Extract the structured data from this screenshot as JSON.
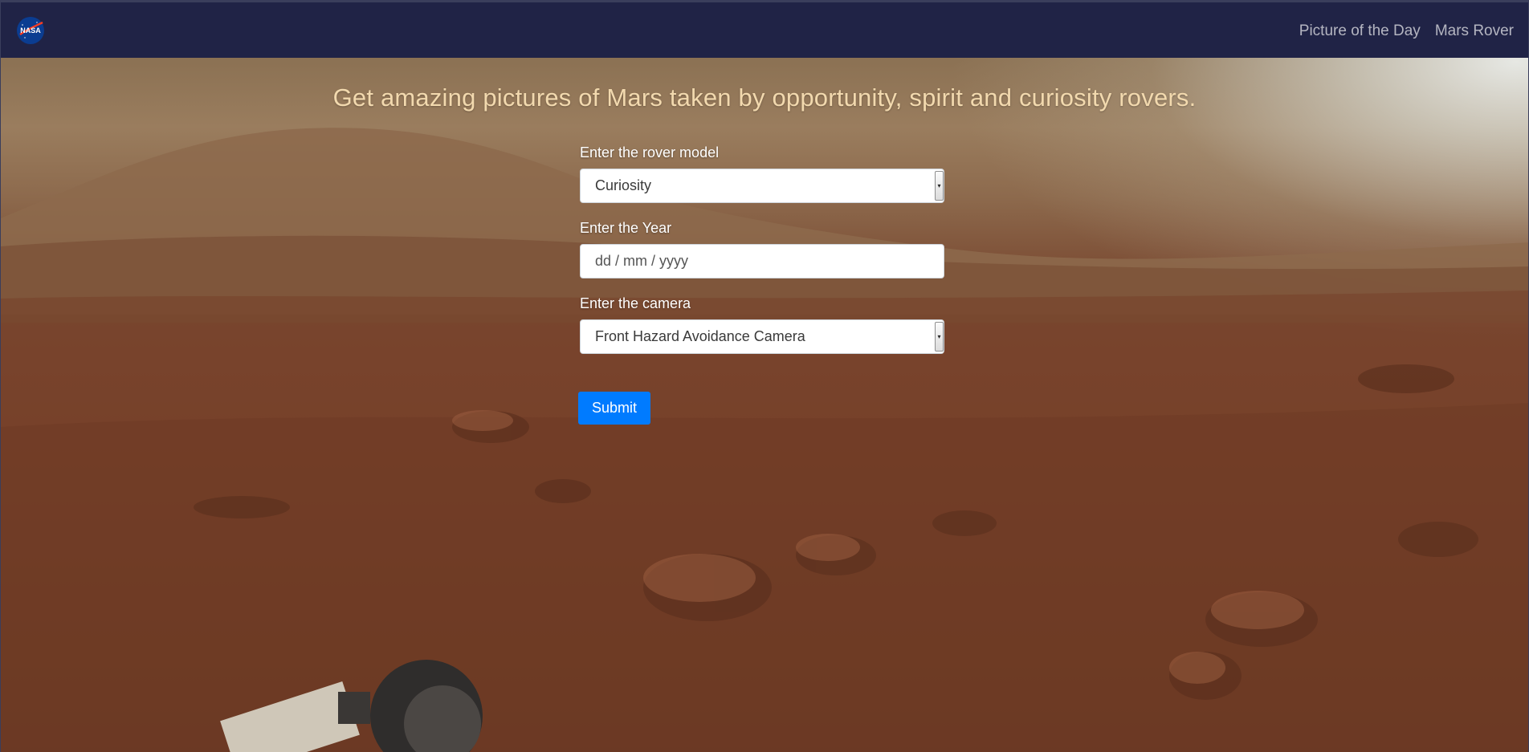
{
  "navbar": {
    "logo_text": "NASA",
    "links": [
      "Picture of the Day",
      "Mars Rover"
    ]
  },
  "headline": "Get amazing pictures of Mars taken by opportunity, spirit and curiosity rovers.",
  "form": {
    "rover_label": "Enter the rover model",
    "rover_value": "Curiosity",
    "year_label": "Enter the Year",
    "year_placeholder": "dd / mm / yyyy",
    "camera_label": "Enter the camera",
    "camera_value": "Front Hazard Avoidance Camera",
    "submit_label": "Submit"
  },
  "colors": {
    "navbar_bg": "#202346",
    "headline": "#f2d9ae",
    "submit_bg": "#007bff"
  },
  "icons": {
    "logo": "nasa-meatball-icon",
    "select": "dropdown-arrow-icon"
  }
}
